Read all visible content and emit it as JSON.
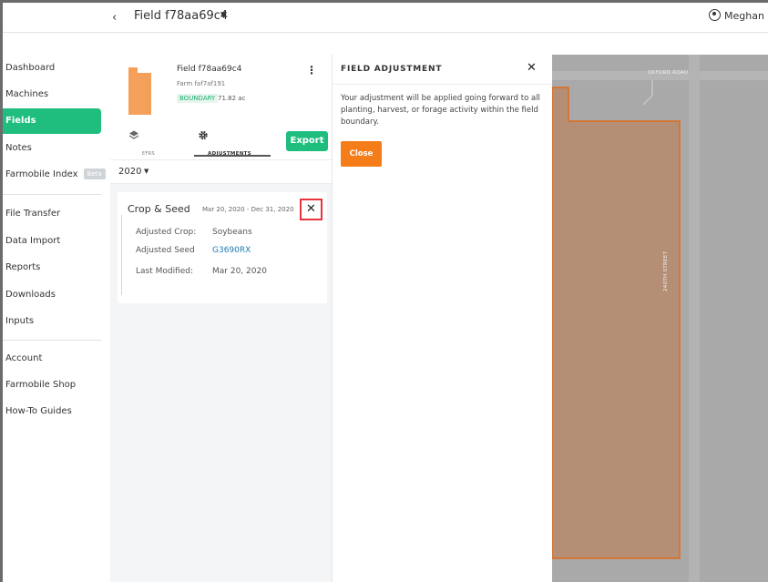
{
  "topbar": {
    "back_glyph": "‹",
    "field_title": "Field f78aa69c4",
    "field_caret": "▼",
    "user_name": "Meghan O'E"
  },
  "sidebar": {
    "items": [
      {
        "label": "Dashboard"
      },
      {
        "label": "Machines"
      },
      {
        "label": "Fields",
        "active": true
      },
      {
        "label": "Notes"
      },
      {
        "label": "Farmobile Index",
        "badge": "Beta"
      },
      {
        "label": "File Transfer"
      },
      {
        "label": "Data Import"
      },
      {
        "label": "Reports"
      },
      {
        "label": "Downloads"
      },
      {
        "label": "Inputs"
      },
      {
        "label": "Account"
      },
      {
        "label": "Farmobile Shop"
      },
      {
        "label": "How-To Guides"
      }
    ]
  },
  "field_panel": {
    "name": "Field f78aa69c4",
    "farm": "Farm faf7af191",
    "boundary_label": "BOUNDARY",
    "acres": "71.82 ac",
    "kebab": "⋮",
    "tabs": {
      "efrs": "EFRS",
      "adjustments": "ADJUSTMENTS"
    },
    "export_label": "Export",
    "year": "2020",
    "year_caret": "▼",
    "shape_color": "#f5a05a"
  },
  "adjustment_card": {
    "title": "Crop & Seed",
    "dates": "Mar 20, 2020 - Dec 31, 2020",
    "close_glyph": "✕",
    "rows": [
      {
        "label": "Adjusted Crop:",
        "value": "Soybeans"
      },
      {
        "label": "Adjusted Seed",
        "value": "G3690RX"
      },
      {
        "label": "Last Modified:",
        "value": "Mar 20, 2020"
      }
    ]
  },
  "dialog": {
    "title": "FIELD ADJUSTMENT",
    "close_glyph": "✕",
    "message": "Your adjustment will be applied going forward to all planting, harvest, or forage activity within the field boundary.",
    "close_button": "Close"
  },
  "map": {
    "road_h": "OXFORD ROAD",
    "road_v": "240TH STREET",
    "boundary_color": "#e06a1c",
    "fill_color": "#b58f75"
  },
  "colors": {
    "accent_green": "#1fbe7f",
    "close_orange": "#f47d1a",
    "highlight_red": "#e8343d"
  }
}
